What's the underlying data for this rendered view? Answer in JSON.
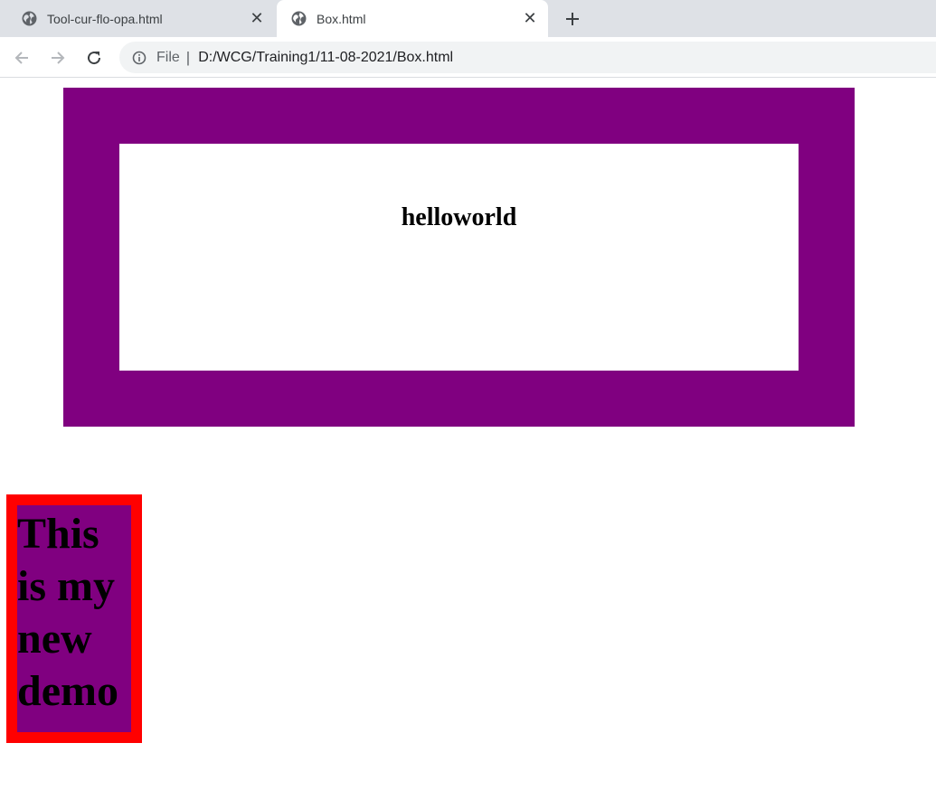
{
  "browser": {
    "tabs": [
      {
        "title": "Tool-cur-flo-opa.html",
        "active": false
      },
      {
        "title": "Box.html",
        "active": true
      }
    ],
    "address": {
      "scheme_label": "File",
      "url": "D:/WCG/Training1/11-08-2021/Box.html"
    }
  },
  "page": {
    "heading": "helloworld",
    "demo_text": "This is my new demo"
  },
  "colors": {
    "purple": "#800080",
    "red": "#ff0000",
    "white": "#ffffff"
  }
}
